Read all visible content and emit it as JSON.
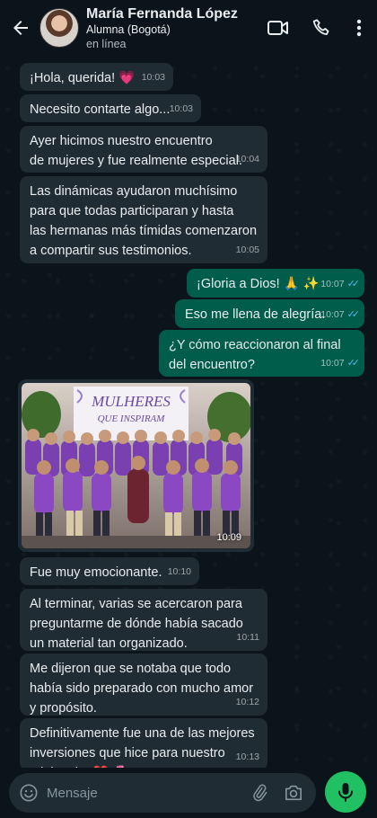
{
  "contact": {
    "name": "María Fernanda López",
    "subtitle": "Alumna (Bogotá)",
    "status": "en línea"
  },
  "icons": {
    "back": "arrow-left-icon",
    "video": "video-call-icon",
    "call": "phone-icon",
    "menu": "more-vertical-icon",
    "emoji": "emoji-icon",
    "attach": "attach-icon",
    "camera": "camera-icon",
    "mic": "mic-icon"
  },
  "colors": {
    "incoming": "#202c33",
    "outgoing": "#005c4b",
    "accent": "#21c063",
    "read_ticks": "#53bdeb"
  },
  "messages": [
    {
      "dir": "in",
      "text": "¡Hola, querida! 💗",
      "time": "10:03"
    },
    {
      "dir": "in",
      "text": "Necesito contarte algo...",
      "time": "10:03"
    },
    {
      "dir": "in",
      "text": "Ayer hicimos nuestro encuentro\nde mujeres y fue realmente especial.",
      "time": "10:04"
    },
    {
      "dir": "in",
      "text": "Las dinámicas ayudaron muchísimo\npara que todas participaran y hasta\nlas hermanas más tímidas comenzaron\na compartir sus testimonios.",
      "time": "10:05"
    },
    {
      "dir": "out",
      "text": "¡Gloria a Dios! 🙏 ✨",
      "time": "10:07"
    },
    {
      "dir": "out",
      "text": "Eso me llena de alegría.",
      "time": "10:07"
    },
    {
      "dir": "out",
      "text": "¿Y cómo reaccionaron al final\ndel encuentro?",
      "time": "10:07"
    },
    {
      "dir": "in",
      "type": "image",
      "banner_line1": "MULHERES",
      "banner_line2": "QUE INSPIRAM",
      "time": "10:09"
    },
    {
      "dir": "in",
      "text": "Fue muy emocionante.",
      "time": "10:10"
    },
    {
      "dir": "in",
      "text": "Al terminar, varias se acercaron para\npreguntarme de dónde había sacado\nun material tan organizado.",
      "time": "10:11"
    },
    {
      "dir": "in",
      "text": "Me dijeron que se notaba que todo\nhabía sido preparado con mucho amor\ny propósito.",
      "time": "10:12"
    },
    {
      "dir": "in",
      "text": "Definitivamente fue una de las mejores\ninversiones que hice para nuestro\nministerio. ❤️ 🌷",
      "time": "10:13"
    }
  ],
  "composer": {
    "placeholder": "Mensaje"
  }
}
